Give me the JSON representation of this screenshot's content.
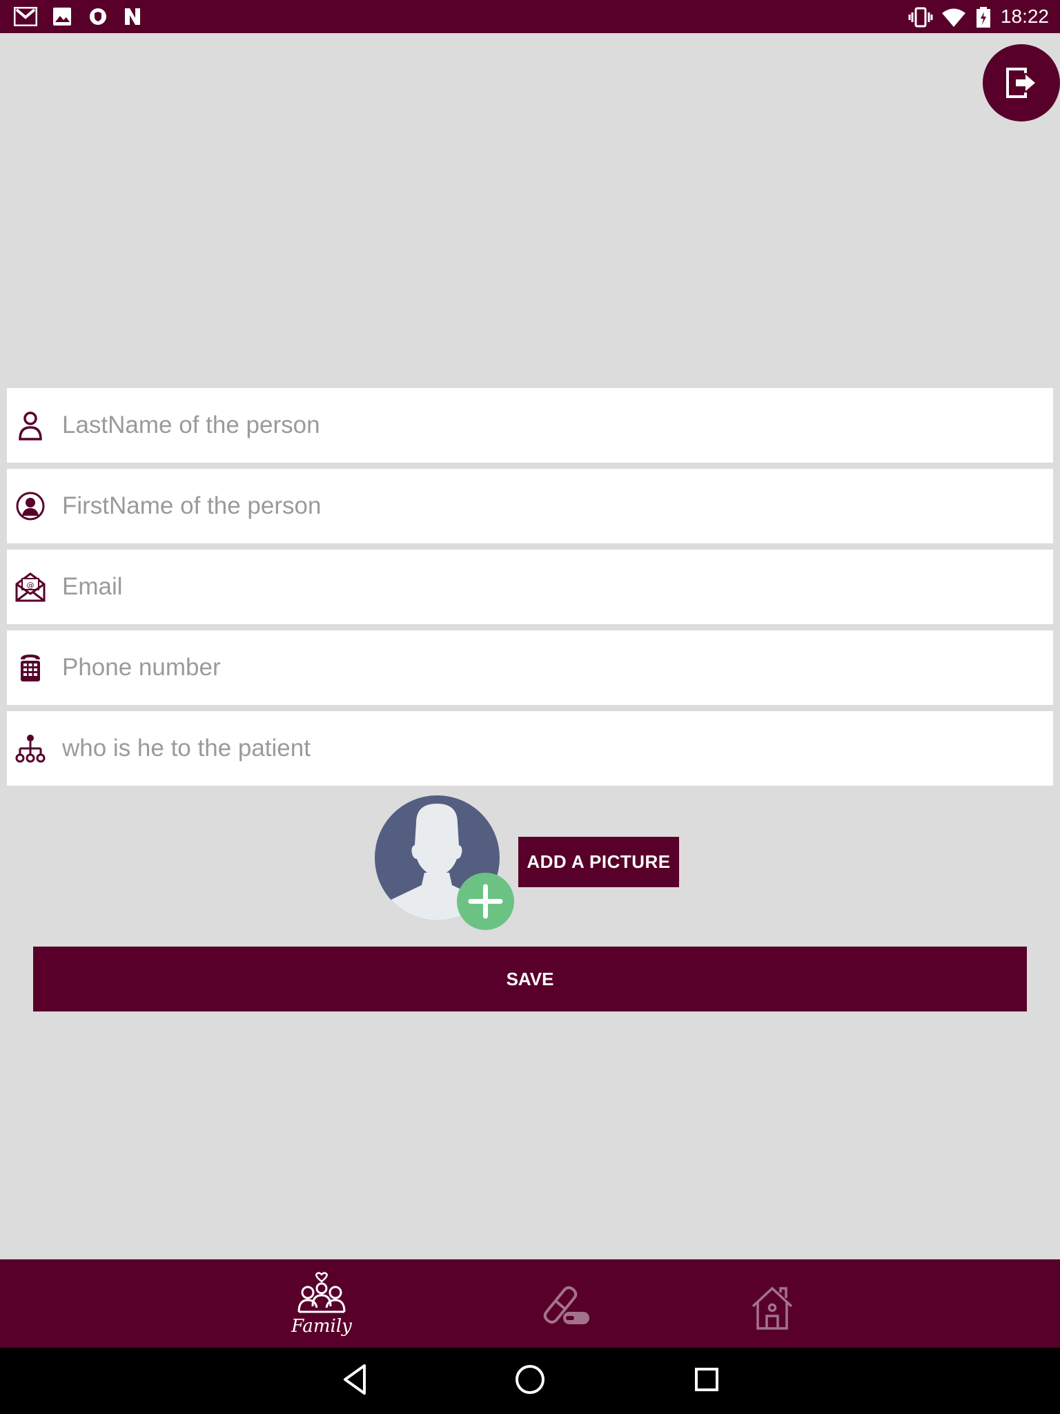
{
  "status_bar": {
    "time": "18:22",
    "left_icons": [
      "gmail-icon",
      "image-icon",
      "shield-icon",
      "n-icon"
    ],
    "right_icons": [
      "vibrate-icon",
      "wifi-icon",
      "battery-charging-icon"
    ]
  },
  "fab": {
    "icon": "logout-icon"
  },
  "form": {
    "lastname": {
      "placeholder": "LastName of the person",
      "value": "",
      "icon": "person-outline-icon"
    },
    "firstname": {
      "placeholder": "FirstName of the person",
      "value": "",
      "icon": "person-circle-icon"
    },
    "email": {
      "placeholder": "Email",
      "value": "",
      "icon": "envelope-icon"
    },
    "phone": {
      "placeholder": "Phone number",
      "value": "",
      "icon": "phone-keypad-icon"
    },
    "relation": {
      "placeholder": "who is he to the patient",
      "value": "",
      "icon": "hierarchy-icon"
    }
  },
  "picture": {
    "avatar_icon": "avatar-placeholder-icon",
    "add_icon": "plus-circle-icon",
    "button_label": "ADD A PICTURE"
  },
  "save_label": "SAVE",
  "bottom_nav": [
    {
      "label": "Family",
      "icon": "family-icon",
      "active": true
    },
    {
      "label": "",
      "icon": "pill-icon",
      "active": false
    },
    {
      "label": "",
      "icon": "home-icon",
      "active": false
    }
  ],
  "colors": {
    "brand": "#58002a",
    "background": "#dcdcdc",
    "avatar_blue": "#545e80",
    "add_green": "#6cc282"
  }
}
